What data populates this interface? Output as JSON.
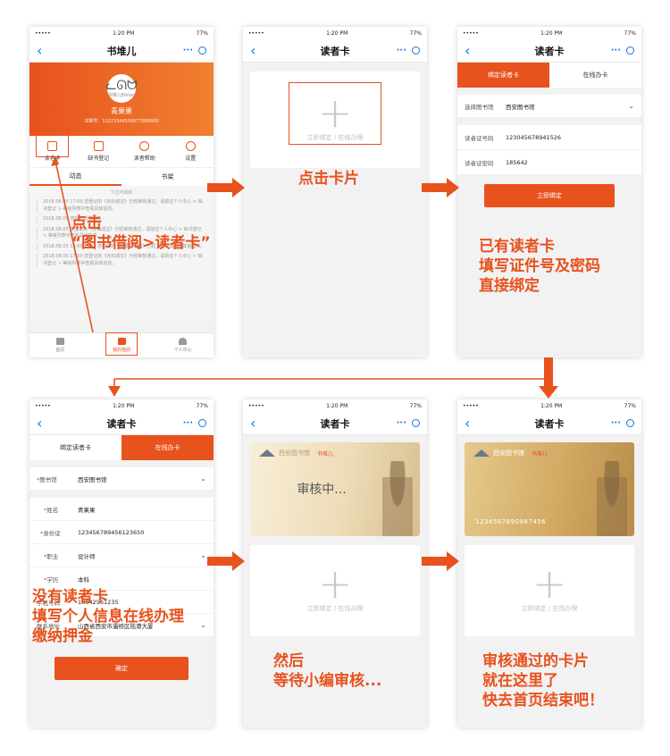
{
  "status": {
    "carrier": "•••••",
    "time": "1:20 PM",
    "battery": "77%"
  },
  "screen1": {
    "title": "书堆儿",
    "avatar_text": "书堆儿Elmao",
    "user_name": "青果果",
    "user_id": "书堆号：11223344556677889900",
    "icons": [
      "读者卡",
      "缺书登记",
      "读者帮助",
      "设置"
    ],
    "subtabs": [
      "动态",
      "书架"
    ],
    "pull_hint": "下拉可刷新",
    "feed": [
      "2018.08.05  17:00  您登记的《赤石成宝》已经审核通过，请前往个人中心 > 缺书登记 > 等级列表中查看具体信息。",
      "2018.08.05  您好，您借阅的…",
      "2018.08.05  您登记的《赤石成宝》已经审核通过，请前往个人中心 > 缺书登记 > 等级列表中查看具体信息。",
      "2018.08.05  15:00  您好，您借阅的《我要的幸福》已经下架，请借阅其他图书。",
      "2018.08.05  17:00  您登记的《赤石成宝》已经审核通过，请前往个人中心 > 缺书登记 > 等级列表中查看具体信息。"
    ],
    "tabbar": [
      "首页",
      "我的借阅",
      "个人中心"
    ]
  },
  "screen2": {
    "title": "读者卡",
    "add_text": "立即绑定 / 在线办理"
  },
  "screen3": {
    "title": "读者卡",
    "tabs": [
      "绑定读者卡",
      "在线办卡"
    ],
    "library_label": "选择图书馆",
    "library_value": "西安图书馆",
    "card_label": "读者证号码",
    "card_value": "123045678941526",
    "pwd_label": "读者证密码",
    "pwd_value": "185642",
    "button": "立即绑定"
  },
  "screen4": {
    "title": "读者卡",
    "tabs": [
      "绑定读者卡",
      "在线办卡"
    ],
    "fields": [
      {
        "label": "图书馆",
        "value": "西安图书馆"
      },
      {
        "label": "姓名",
        "value": "青果果"
      },
      {
        "label": "身份证",
        "value": "123456789456123650"
      },
      {
        "label": "职业",
        "value": "设计师"
      },
      {
        "label": "学历",
        "value": "本科"
      },
      {
        "label": "手机号码",
        "value": "13642561235"
      },
      {
        "label": "联系地址",
        "value": "山西省西安市灞桥区陆港大厦"
      }
    ],
    "button": "确定"
  },
  "screen5": {
    "title": "读者卡",
    "library_name": "西安图书馆",
    "brand": "书堆儿",
    "status": "审核中...",
    "add_text": "立即绑定 / 在线办理"
  },
  "screen6": {
    "title": "读者卡",
    "library_name": "西安图书馆",
    "brand": "书堆儿",
    "card_no": "1234567890987456",
    "add_text": "立即绑定 / 在线办理"
  },
  "annotations": {
    "click_reader": "点击\n“图书借阅>读者卡”",
    "click_card": "点击卡片",
    "bind_existing": "已有读者卡\n填写证件号及密码\n直接绑定",
    "apply_online": "没有读者卡\n填写个人信息在线办理\n缴纳押金",
    "wait_review": "然后\n等待小编审核...",
    "approved": "审核通过的卡片\n就在这里了\n快去首页结束吧！"
  },
  "colors": {
    "accent": "#e8521d",
    "link": "#1a73d9"
  }
}
